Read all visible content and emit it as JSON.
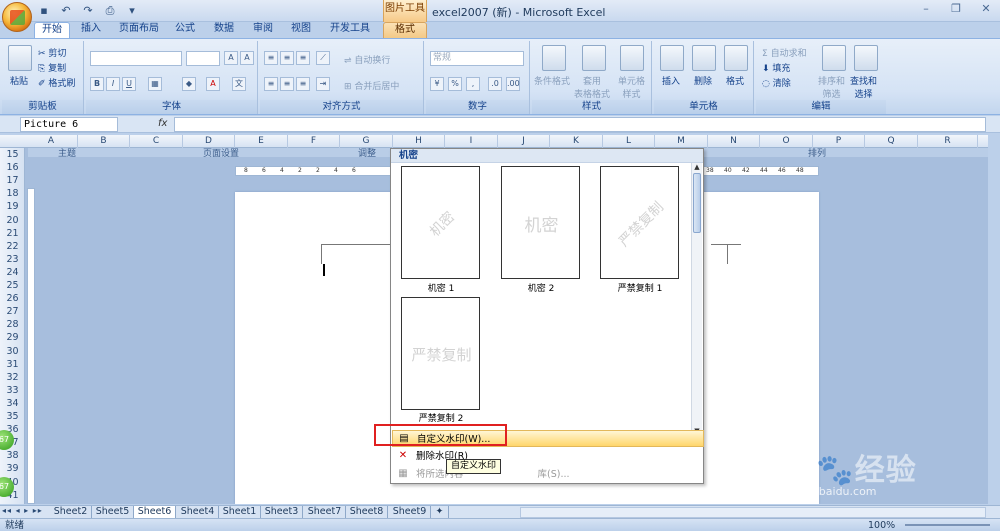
{
  "titlebar": {
    "context_tab_header": "图片工具",
    "app_title": "excel2007 (新) - Microsoft Excel",
    "win_buttons": [
      "–",
      "❐",
      "✕"
    ]
  },
  "ribbon_tabs": [
    "开始",
    "插入",
    "页面布局",
    "公式",
    "数据",
    "审阅",
    "视图",
    "开发工具",
    "格式"
  ],
  "ribbon": {
    "clipboard": {
      "paste": "粘贴",
      "cut": "剪切",
      "copy": "复制",
      "format_painter": "格式刷",
      "label": "剪贴板"
    },
    "font": {
      "label": "字体"
    },
    "alignment": {
      "wrap": "自动换行",
      "merge": "合并后居中",
      "label": "对齐方式"
    },
    "number": {
      "format": "常规",
      "label": "数字"
    },
    "styles": {
      "conditional": "条件格式",
      "table": "套用\n表格格式",
      "cell_style": "单元格\n样式",
      "label": "样式"
    },
    "cells": {
      "insert": "插入",
      "delete": "删除",
      "format": "格式",
      "label": "单元格"
    },
    "editing": {
      "autosum": "自动求和",
      "fill": "填充",
      "clear": "清除",
      "sort": "排序和\n筛选",
      "find": "查找和\n选择",
      "label": "编辑"
    }
  },
  "formula_bar": {
    "name_box": "Picture 6",
    "fx": "fx"
  },
  "columns": [
    "A",
    "B",
    "C",
    "D",
    "E",
    "F",
    "G",
    "H",
    "I",
    "J",
    "K",
    "L",
    "M",
    "N",
    "O",
    "P",
    "Q",
    "R"
  ],
  "rows": [
    "15",
    "16",
    "17",
    "18",
    "19",
    "20",
    "21",
    "22",
    "23",
    "24",
    "25",
    "26",
    "27",
    "28",
    "29",
    "30",
    "31",
    "32",
    "33",
    "34",
    "35",
    "36",
    "37",
    "38",
    "39",
    "40",
    "41"
  ],
  "band_labels": {
    "theme": "主题",
    "page_setup": "页面设置",
    "fit": "调整",
    "arrange": "排列"
  },
  "ruler_left": [
    "8",
    "6",
    "4",
    "2",
    "2",
    "4",
    "6"
  ],
  "ruler_right": [
    "38",
    "40",
    "42",
    "44",
    "46",
    "48"
  ],
  "dropdown": {
    "header": "机密",
    "items": [
      {
        "text": "机密",
        "label": "机密 1",
        "rotated": true
      },
      {
        "text": "机密",
        "label": "机密 2",
        "rotated": false
      },
      {
        "text": "严禁复制",
        "label": "严禁复制 1",
        "rotated": true
      },
      {
        "text": "严禁复制",
        "label": "严禁复制 2",
        "rotated": false
      }
    ],
    "menu": {
      "custom": "自定义水印(W)...",
      "remove": "删除水印(R)",
      "save_prefix": "将所选内容",
      "save_suffix": "库(S)..."
    },
    "tooltip": "自定义水印"
  },
  "sheet_tabs": [
    "Sheet2",
    "Sheet5",
    "Sheet6",
    "Sheet4",
    "Sheet1",
    "Sheet3",
    "Sheet7",
    "Sheet8",
    "Sheet9"
  ],
  "active_sheet": "Sheet6",
  "status": {
    "ready": "就绪",
    "zoom": "100%"
  },
  "overlay": {
    "brand": "Bai",
    "brand2": "经验",
    "url": "jingyan.baidu.com"
  },
  "green_ball": "67"
}
